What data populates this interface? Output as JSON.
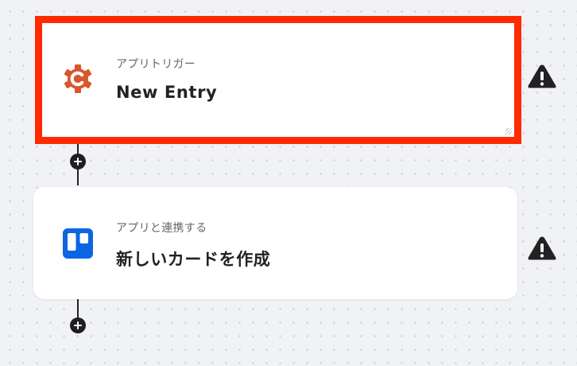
{
  "steps": [
    {
      "type_label": "アプリトリガー",
      "title": "New Entry",
      "app_icon": "cognito-forms-gear-icon",
      "status_icon": "warning-icon",
      "highlighted": true
    },
    {
      "type_label": "アプリと連携する",
      "title": "新しいカードを作成",
      "app_icon": "trello-icon",
      "status_icon": "warning-icon",
      "highlighted": false
    }
  ],
  "colors": {
    "highlight": "#ff2a00",
    "cognito_orange": "#d9552b",
    "trello_blue": "#0c66e4",
    "canvas": "#f1f2f5"
  }
}
